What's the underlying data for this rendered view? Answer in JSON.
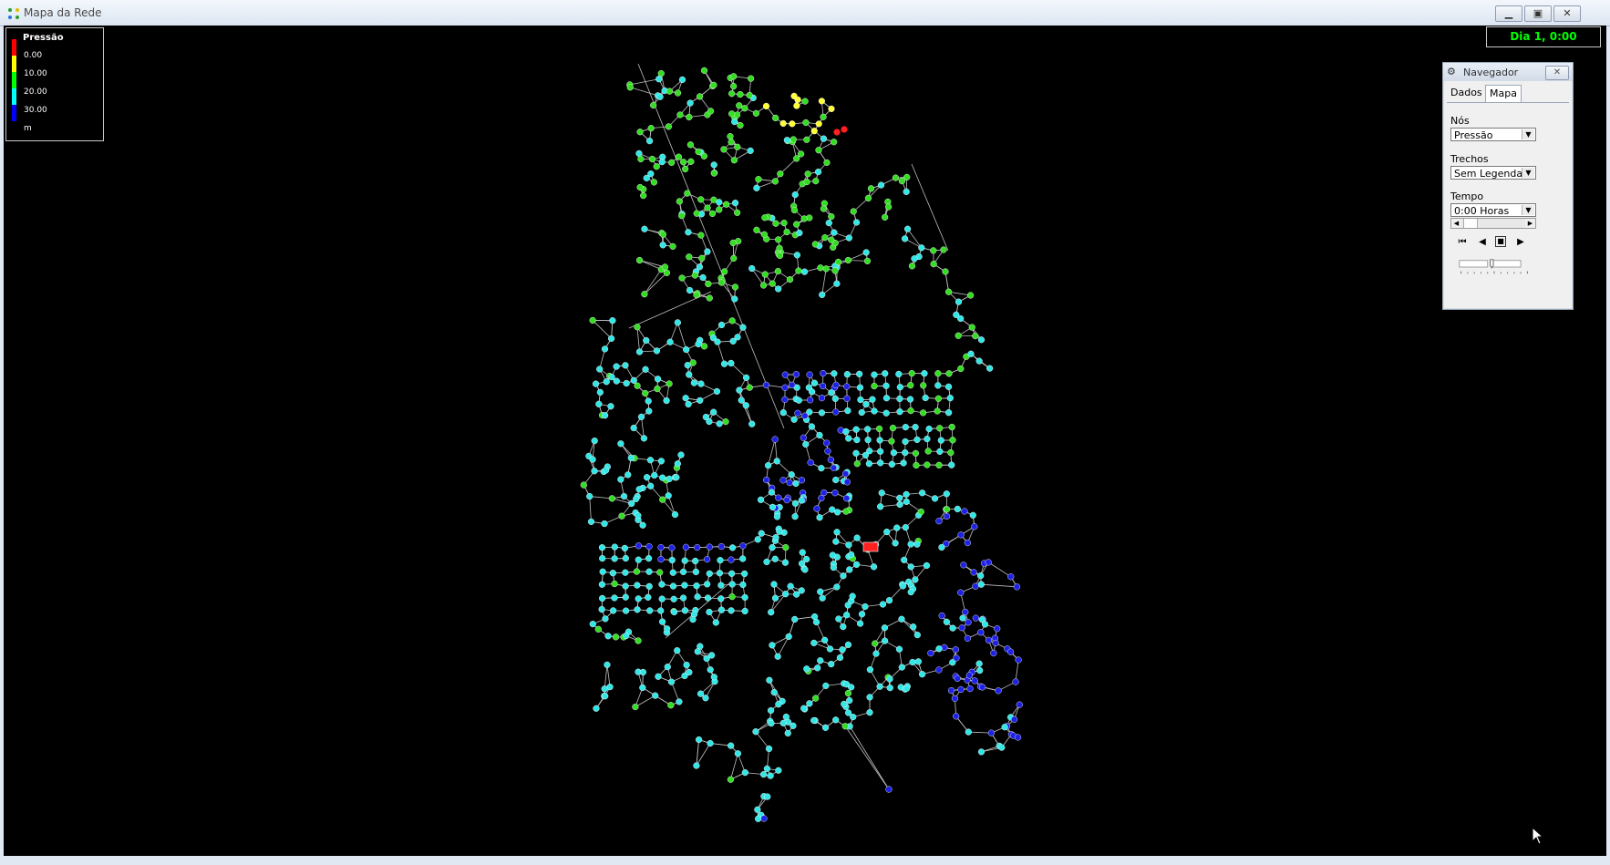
{
  "window": {
    "title": "Mapa da Rede"
  },
  "legend": {
    "title": "Pressão",
    "entries": [
      {
        "label": "0.00",
        "color": "#ff0000"
      },
      {
        "label": "10.00",
        "color": "#ffff00"
      },
      {
        "label": "20.00",
        "color": "#00ff00"
      },
      {
        "label": "30.00",
        "color": "#00ffff"
      },
      {
        "label": "m",
        "color": "#0000ff"
      }
    ]
  },
  "clock": {
    "text": "Dia 1, 0:00"
  },
  "navigator": {
    "title": "Navegador",
    "tabs": [
      "Dados",
      "Mapa"
    ],
    "active_tab": "Mapa",
    "nodes_label": "Nós",
    "nodes_value": "Pressão",
    "links_label": "Trechos",
    "links_value": "Sem Legenda",
    "time_label": "Tempo",
    "time_value": "0:00 Horas"
  },
  "colors": {
    "red": "#ff2020",
    "yellow": "#ffff33",
    "green": "#33dd22",
    "cyan": "#33e6e6",
    "blue": "#1e22e6",
    "link": "#bfbfbf",
    "map_bg": "#000000"
  },
  "icons": [
    "app-network-icon",
    "minimize-icon",
    "restore-icon",
    "close-icon",
    "navigator-icon",
    "first-icon",
    "rewind-icon",
    "stop-icon",
    "play-icon",
    "mouse-cursor-icon"
  ]
}
